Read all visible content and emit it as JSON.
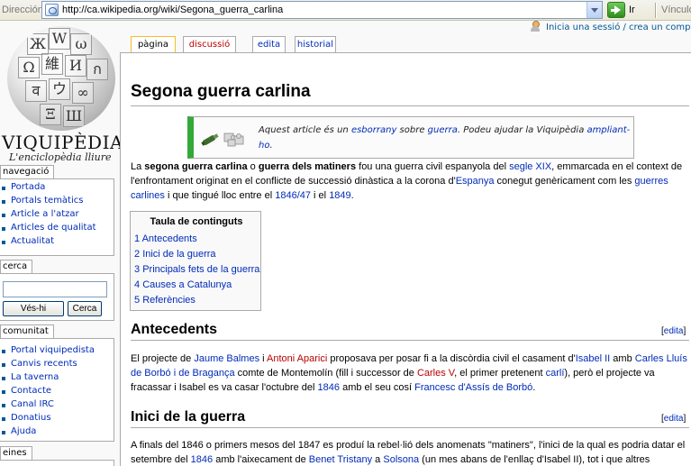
{
  "browser": {
    "address_label": "Dirección",
    "url": "http://ca.wikipedia.org/wiki/Segona_guerra_carlina",
    "go_label": "Ir",
    "links_label": "Vínculos"
  },
  "personal": {
    "login_link": "Inicia una sessió / crea un compte"
  },
  "logo": {
    "title": "VIQUIPÈDIA",
    "tagline": "L'enciclopèdia lliure"
  },
  "tabs": [
    {
      "label": "pàgina"
    },
    {
      "label": "discussió"
    },
    {
      "label": "edita"
    },
    {
      "label": "historial"
    }
  ],
  "sidebar": {
    "navigation": {
      "title": "navegació",
      "items": [
        "Portada",
        "Portals temàtics",
        "Article a l'atzar",
        "Articles de qualitat",
        "Actualitat"
      ]
    },
    "search": {
      "title": "cerca",
      "go_button": "Vés-hi",
      "search_button": "Cerca"
    },
    "community": {
      "title": "comunitat",
      "items": [
        "Portal viquipedista",
        "Canvis recents",
        "La taverna",
        "Contacte",
        "Canal IRC",
        "Donatius",
        "Ajuda"
      ]
    },
    "tools": {
      "title": "eines"
    }
  },
  "article": {
    "title": "Segona guerra carlina",
    "stub": {
      "t1": "Aquest article és un ",
      "l1": "esborrany",
      "t2": " sobre ",
      "l2": "guerra",
      "t3": ". Podeu ajudar la Viquipèdia ",
      "l3": "ampliant-ho",
      "t4": "."
    },
    "intro": {
      "t1": "La ",
      "b1": "segona guerra carlina",
      "t2": " o ",
      "b2": "guerra dels matiners",
      "t3": " fou una guerra civil espanyola del ",
      "l1": "segle XIX",
      "t4": ", emmarcada en el context de l'enfrontament originat en el conflicte de successió dinàstica a la corona d'",
      "l2": "Espanya",
      "t5": " conegut genèricament com les ",
      "l3": "guerres carlines",
      "t6": " i que tingué lloc entre el ",
      "l4": "1846",
      "l5": "/47",
      "t7": " i el ",
      "l6": "1849",
      "t8": "."
    },
    "toc": {
      "title": "Taula de continguts",
      "items": [
        {
          "num": "1",
          "label": "Antecedents"
        },
        {
          "num": "2",
          "label": "Inici de la guerra"
        },
        {
          "num": "3",
          "label": "Principals fets de la guerra"
        },
        {
          "num": "4",
          "label": "Causes a Catalunya"
        },
        {
          "num": "5",
          "label": "Referències"
        }
      ]
    },
    "section1": {
      "heading": "Antecedents",
      "edit": "edita",
      "t1": "El projecte de ",
      "l1": "Jaume Balmes",
      "t2": " i ",
      "l2": "Antoni Aparici",
      "t3": " proposava per posar fi a la discòrdia civil el casament d'",
      "l3": "Isabel II",
      "t4": " amb ",
      "l4": "Carles Lluís de Borbó i de Bragança",
      "t5": " comte de Montemolín (fill i successor de ",
      "l5": "Carles V",
      "t6": ", el primer pretenent ",
      "l6": "carlí",
      "t7": "), però el projecte va fracassar i Isabel es va casar l'octubre del ",
      "l7": "1846",
      "t8": " amb el seu cosí ",
      "l8": "Francesc d'Assís de Borbó",
      "t9": "."
    },
    "section2": {
      "heading": "Inici de la guerra",
      "edit": "edita",
      "t1": "A finals del 1846 o primers mesos del 1847 es produí la rebel·lió dels anomenats \"matiners\", l'inici de la qual es podria datar el setembre del ",
      "l1": "1846",
      "t2": " amb l'aixecament de ",
      "l2": "Benet Tristany",
      "t3": " a ",
      "l3": "Solsona",
      "t4": " (un mes abans de l'enllaç d'Isabel II), tot i que altres"
    }
  }
}
